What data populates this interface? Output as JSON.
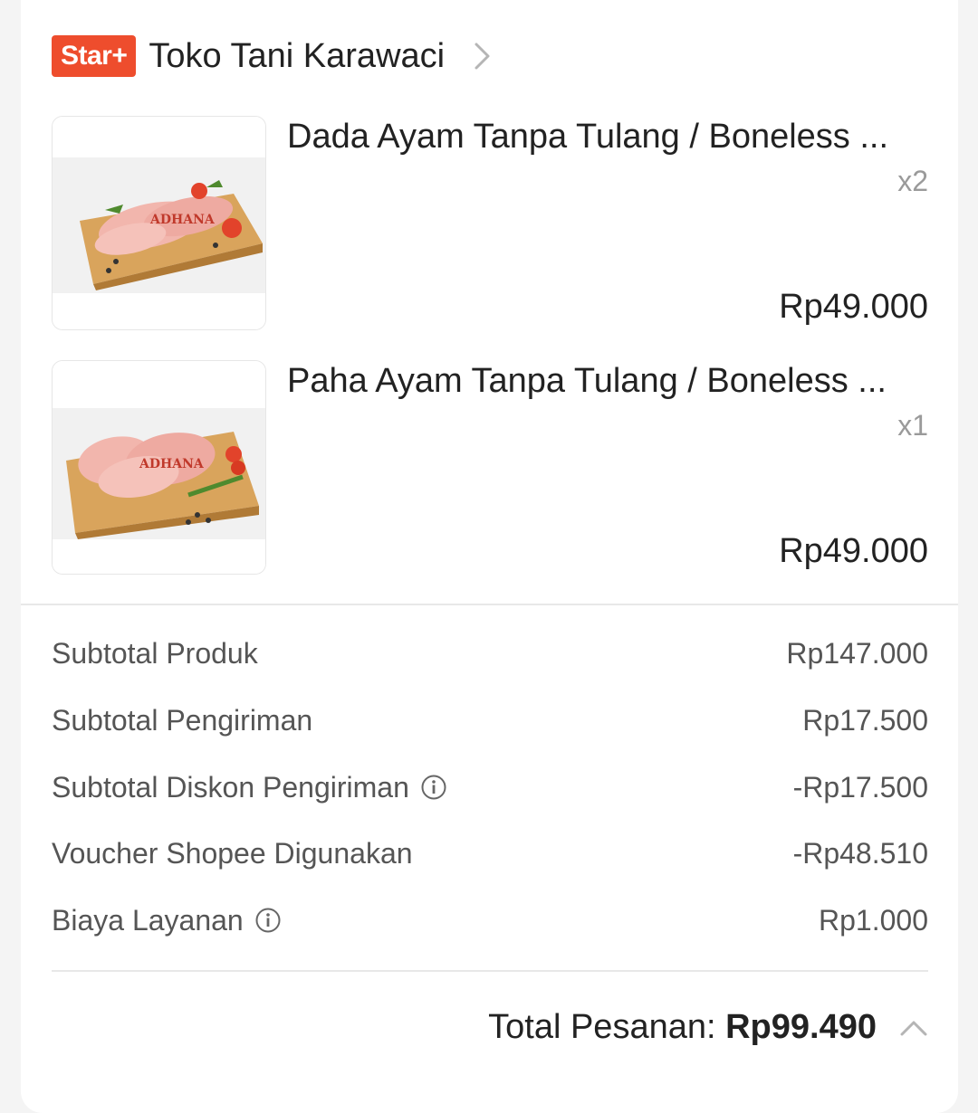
{
  "shop": {
    "badge": "Star+",
    "name": "Toko Tani Karawaci",
    "badge_color": "#ee4d2d"
  },
  "products": [
    {
      "name": "Dada Ayam Tanpa Tulang / Boneless ...",
      "qty": "x2",
      "price": "Rp49.000",
      "image_icon": "chicken-breast-on-board"
    },
    {
      "name": "Paha Ayam Tanpa Tulang / Boneless ...",
      "qty": "x1",
      "price": "Rp49.000",
      "image_icon": "chicken-thigh-on-board"
    }
  ],
  "summary": [
    {
      "label": "Subtotal Produk",
      "value": "Rp147.000"
    },
    {
      "label": "Subtotal Pengiriman",
      "value": "Rp17.500"
    },
    {
      "label": "Subtotal Diskon Pengiriman",
      "value": "-Rp17.500",
      "info_icon": true
    },
    {
      "label": "Voucher Shopee Digunakan",
      "value": "-Rp48.510"
    },
    {
      "label": "Biaya Layanan",
      "value": "Rp1.000",
      "info_icon": true
    }
  ],
  "total": {
    "label": "Total Pesanan: ",
    "value": "Rp99.490"
  }
}
